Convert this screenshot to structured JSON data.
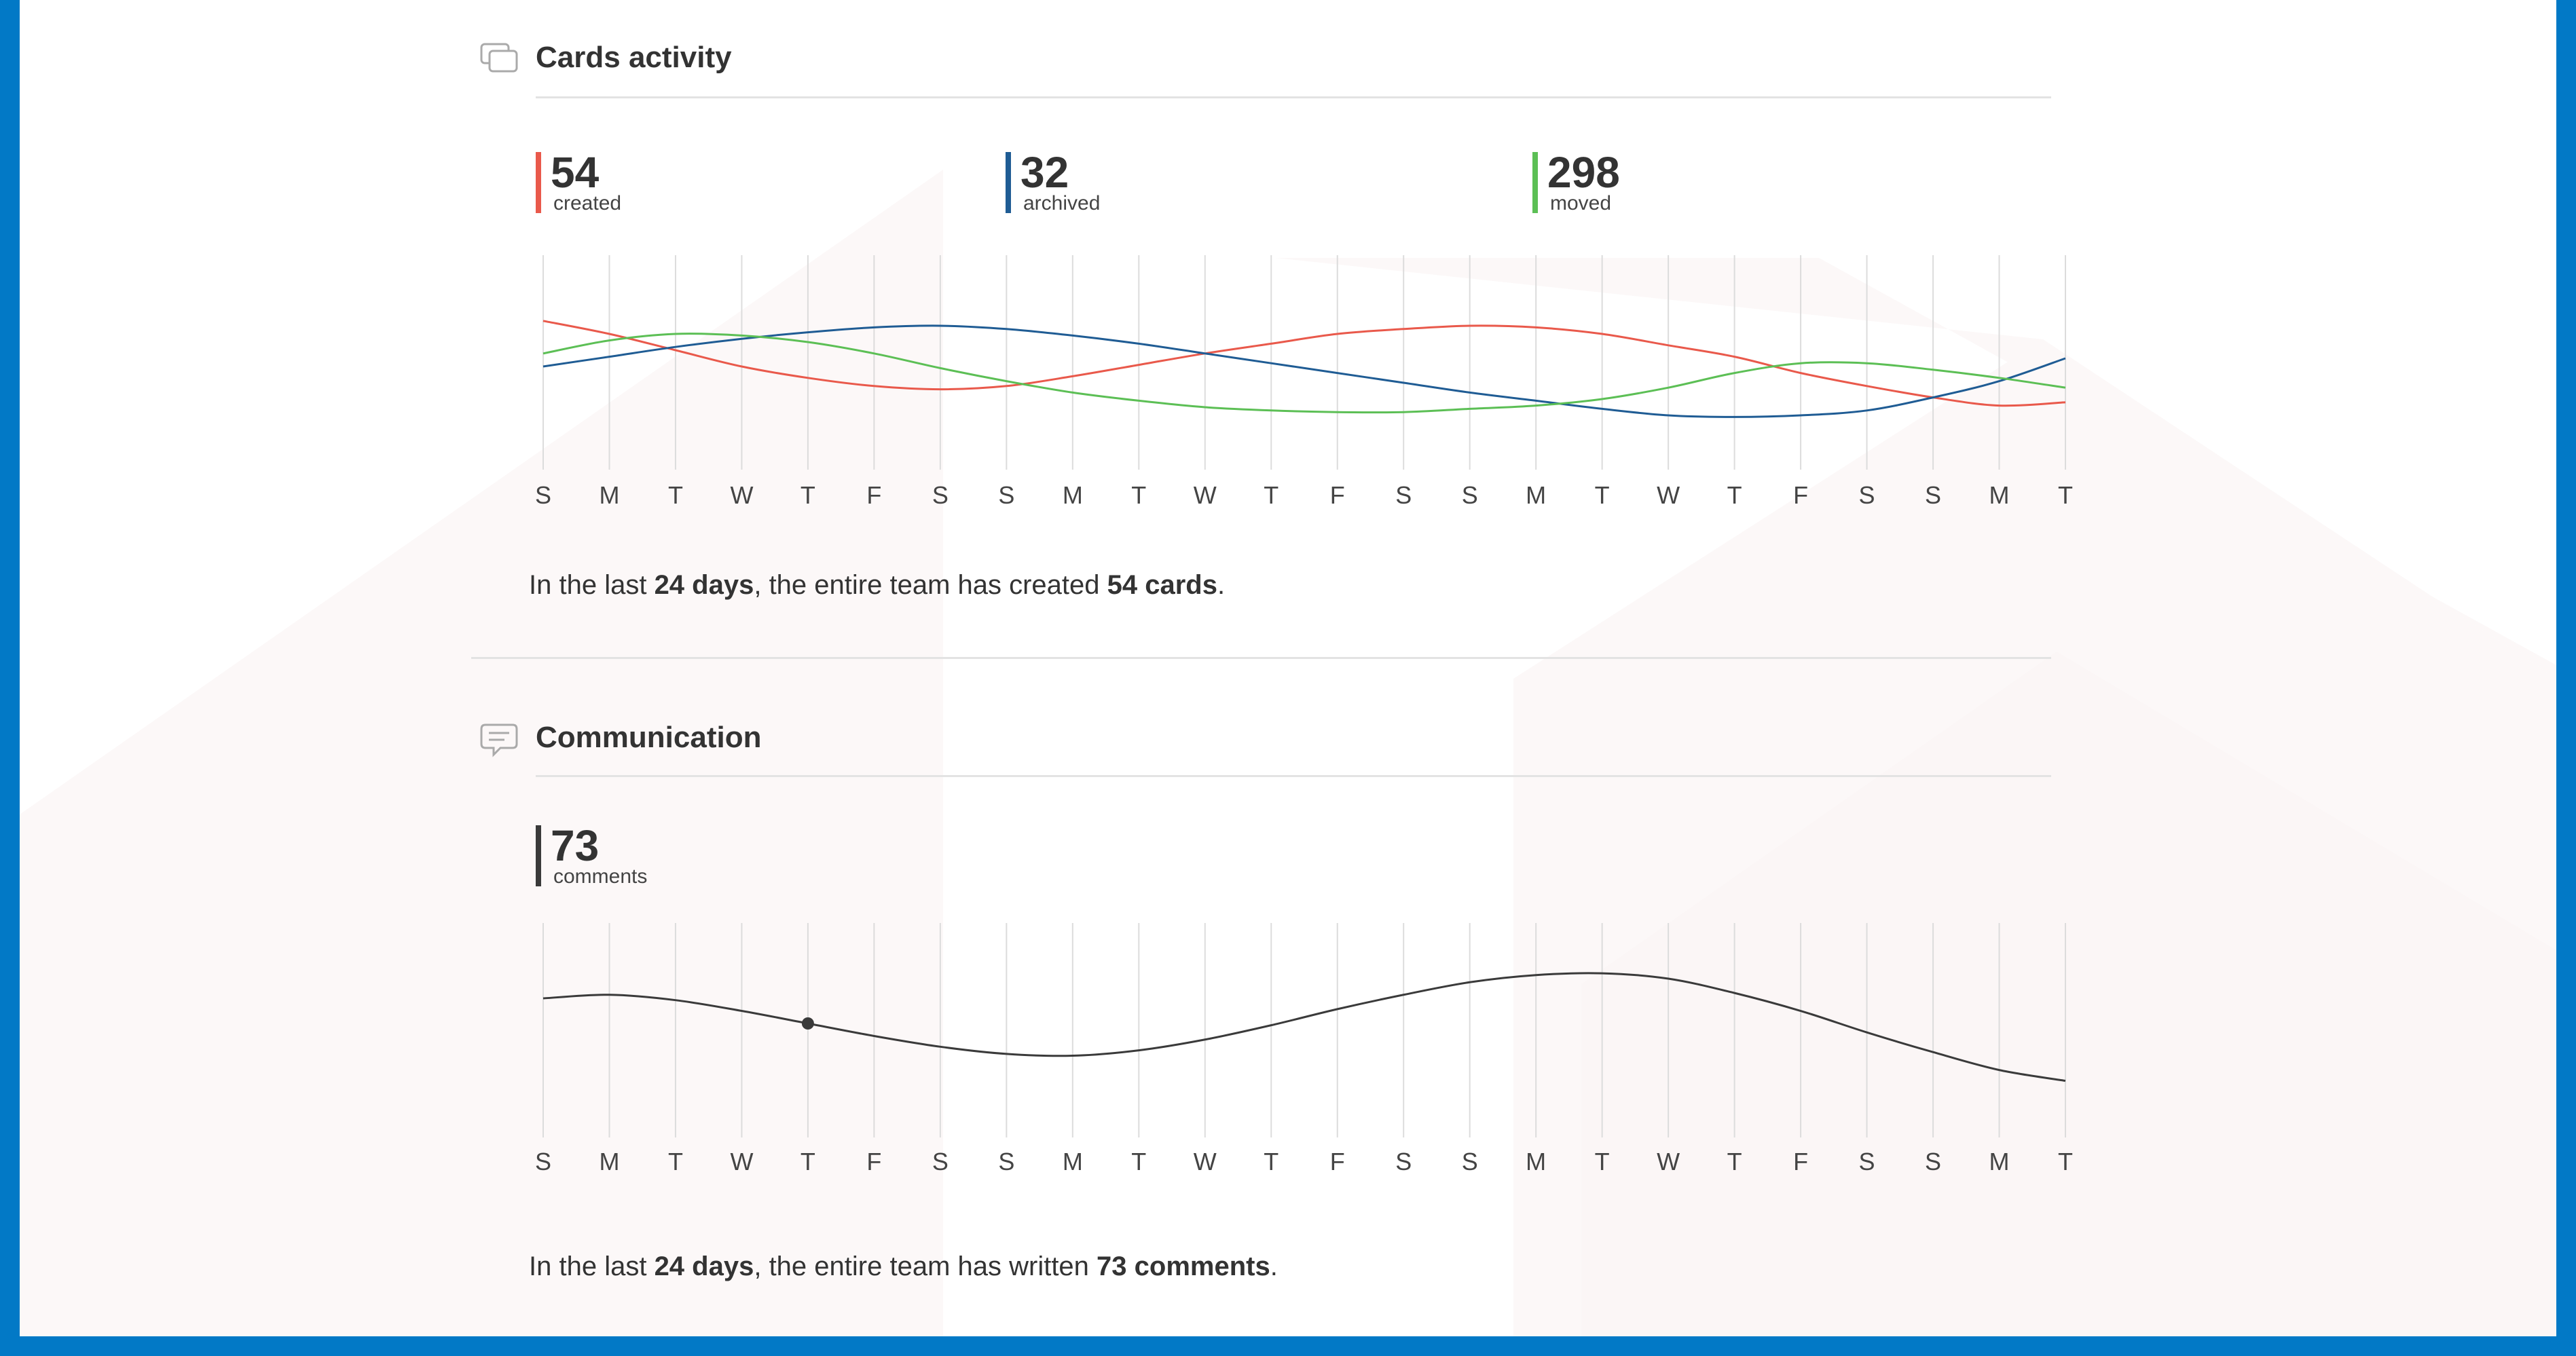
{
  "colors": {
    "frame": "#0279c6",
    "created": "#e9594b",
    "archived": "#1f5c94",
    "moved": "#5cbf55",
    "comments": "#3a3a3a"
  },
  "cards_activity": {
    "title": "Cards activity",
    "icon": "cards-icon",
    "stats": [
      {
        "value": "54",
        "label": "created",
        "color": "#e9594b"
      },
      {
        "value": "32",
        "label": "archived",
        "color": "#1f5c94"
      },
      {
        "value": "298",
        "label": "moved",
        "color": "#5cbf55"
      }
    ],
    "summary": {
      "prefix": "In the last ",
      "days": "24 days",
      "middle": ", the entire team has created ",
      "count": "54 cards",
      "suffix": "."
    }
  },
  "communication": {
    "title": "Communication",
    "icon": "comment-icon",
    "stats": [
      {
        "value": "73",
        "label": "comments",
        "color": "#3a3a3a"
      }
    ],
    "summary": {
      "prefix": "In the last ",
      "days": "24 days",
      "middle": ", the entire team has written ",
      "count": "73 comments",
      "suffix": "."
    }
  },
  "chart_data": [
    {
      "type": "line",
      "categories": [
        "S",
        "M",
        "T",
        "W",
        "T",
        "F",
        "S",
        "S",
        "M",
        "T",
        "W",
        "T",
        "F",
        "S",
        "S",
        "M",
        "T",
        "W",
        "T",
        "F",
        "S",
        "S",
        "M",
        "T"
      ],
      "grid": true,
      "legend": "top-left",
      "ylim": [
        0,
        100
      ],
      "series": [
        {
          "name": "created",
          "color": "#e9594b",
          "values": [
            78,
            70,
            60,
            50,
            43,
            38,
            36,
            38,
            44,
            51,
            58,
            64,
            70,
            73,
            75,
            74,
            70,
            63,
            56,
            46,
            38,
            31,
            26,
            28
          ]
        },
        {
          "name": "archived",
          "color": "#1f5c94",
          "values": [
            50,
            56,
            62,
            67,
            71,
            74,
            75,
            73,
            69,
            64,
            58,
            52,
            46,
            40,
            34,
            29,
            24,
            20,
            19,
            20,
            23,
            31,
            41,
            55
          ]
        },
        {
          "name": "moved",
          "color": "#5cbf55",
          "values": [
            58,
            66,
            70,
            69,
            65,
            58,
            49,
            41,
            34,
            29,
            25,
            23,
            22,
            22,
            24,
            26,
            30,
            37,
            46,
            52,
            52,
            48,
            43,
            37
          ]
        }
      ]
    },
    {
      "type": "line",
      "categories": [
        "S",
        "M",
        "T",
        "W",
        "T",
        "F",
        "S",
        "S",
        "M",
        "T",
        "W",
        "T",
        "F",
        "S",
        "S",
        "M",
        "T",
        "W",
        "T",
        "F",
        "S",
        "S",
        "M",
        "T"
      ],
      "grid": true,
      "legend": "top-left",
      "ylim": [
        0,
        100
      ],
      "highlight_index": 4,
      "series": [
        {
          "name": "comments",
          "color": "#3a3a3a",
          "values": [
            64,
            66,
            63,
            57,
            50,
            43,
            37,
            33,
            32,
            35,
            41,
            49,
            58,
            66,
            73,
            77,
            78,
            75,
            67,
            57,
            45,
            34,
            24,
            18
          ]
        }
      ]
    }
  ]
}
